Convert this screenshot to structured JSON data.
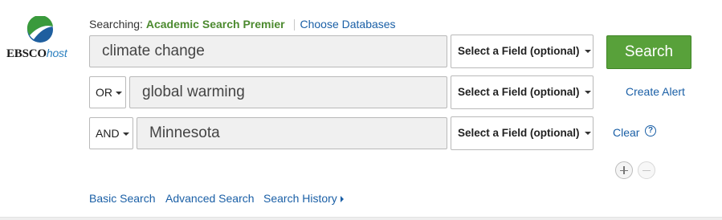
{
  "logo": {
    "brand_bold": "EBSCO",
    "brand_italic": "host"
  },
  "searching": {
    "prefix": "Searching:",
    "database": "Academic Search Premier",
    "choose_link": "Choose Databases"
  },
  "rows": [
    {
      "operator": "",
      "query": "climate change",
      "field": "Select a Field (optional)"
    },
    {
      "operator": "OR",
      "query": "global warming",
      "field": "Select a Field (optional)"
    },
    {
      "operator": "AND",
      "query": "Minnesota",
      "field": "Select a Field (optional)"
    }
  ],
  "actions": {
    "search": "Search",
    "create_alert": "Create Alert",
    "clear": "Clear",
    "help": "?"
  },
  "bottom_links": {
    "basic": "Basic Search",
    "advanced": "Advanced Search",
    "history": "Search History"
  },
  "colors": {
    "search_button": "#58a13a",
    "link": "#1a5fa6",
    "database_name": "#4c8a2f"
  },
  "icons": [
    "ebsco-logo-icon",
    "caret-down-icon",
    "help-icon",
    "plus-icon",
    "minus-icon",
    "triangle-right-icon"
  ]
}
